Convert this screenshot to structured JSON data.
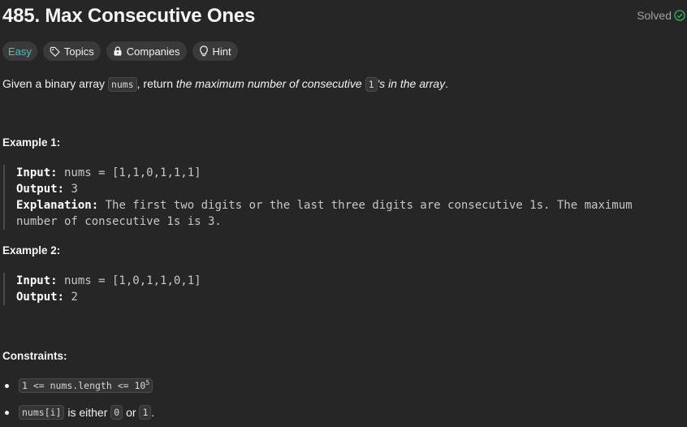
{
  "problem": {
    "title": "485. Max Consecutive Ones",
    "status": "Solved"
  },
  "tags": {
    "difficulty": "Easy",
    "topics": "Topics",
    "companies": "Companies",
    "hint": "Hint"
  },
  "description": {
    "part1": "Given a binary array ",
    "code1": "nums",
    "part2": ", return ",
    "italic1": "the maximum number of consecutive ",
    "code2": "1",
    "italic2": "'s in the array",
    "part3": "."
  },
  "example1": {
    "heading": "Example 1:",
    "input_label": "Input:",
    "input_value": " nums = [1,1,0,1,1,1]",
    "output_label": "Output:",
    "output_value": " 3",
    "explanation_label": "Explanation:",
    "explanation_value": " The first two digits or the last three digits are consecutive 1s. The maximum number of consecutive 1s is 3."
  },
  "example2": {
    "heading": "Example 2:",
    "input_label": "Input:",
    "input_value": " nums = [1,0,1,1,0,1]",
    "output_label": "Output:",
    "output_value": " 2"
  },
  "constraints": {
    "heading": "Constraints:",
    "c1_code": "1 <= nums.length <= 10",
    "c1_sup": "5",
    "c2_code1": "nums[i]",
    "c2_text1": " is either ",
    "c2_code2": "0",
    "c2_text2": " or ",
    "c2_code3": "1",
    "c2_text3": "."
  },
  "colors": {
    "background": "#262626",
    "easy": "#46c6c2",
    "solved_check": "#2cbb5d"
  }
}
